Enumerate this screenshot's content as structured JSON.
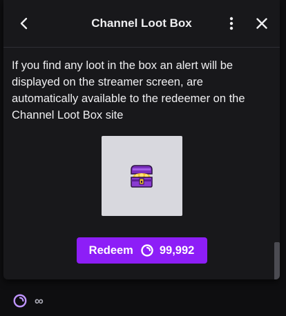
{
  "header": {
    "title": "Channel Loot Box",
    "back_icon": "chevron-left-icon",
    "more_icon": "more-vertical-icon",
    "close_icon": "close-icon"
  },
  "description": "If you find any loot in the box an alert will be displayed on the streamer screen, are automatically available to the redeemer on the Channel Loot Box site",
  "reward_image": {
    "icon": "treasure-chest-icon"
  },
  "redeem": {
    "label": "Redeem",
    "cost": "99,992",
    "points_icon": "channel-points-icon"
  },
  "footer": {
    "points_icon": "channel-points-icon",
    "balance": "∞"
  },
  "colors": {
    "accent": "#8d1ef7",
    "panel_bg": "#18181b",
    "page_bg": "#0e0e10",
    "points_icon": "#bf94ff"
  }
}
